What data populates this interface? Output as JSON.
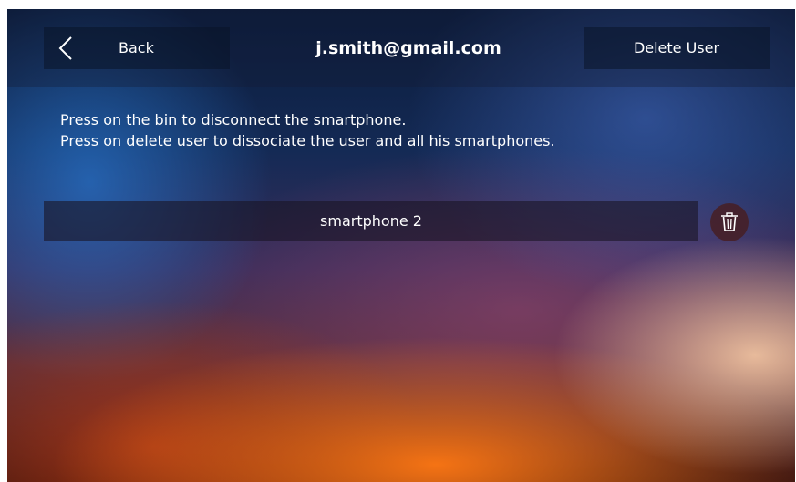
{
  "header": {
    "back_label": "Back",
    "title": "j.smith@gmail.com",
    "delete_user_label": "Delete User"
  },
  "instructions": {
    "line1": "Press on the bin to disconnect the smartphone.",
    "line2": "Press on delete user to dissociate the user and all his smartphones."
  },
  "devices": [
    {
      "name": "smartphone 2",
      "action_icon": "trash-bin-icon"
    }
  ],
  "icons": {
    "back": "chevron-left-icon",
    "bin": "trash-bin-icon"
  },
  "colors": {
    "text": "#ffffff",
    "bin_button": "#46201f"
  }
}
